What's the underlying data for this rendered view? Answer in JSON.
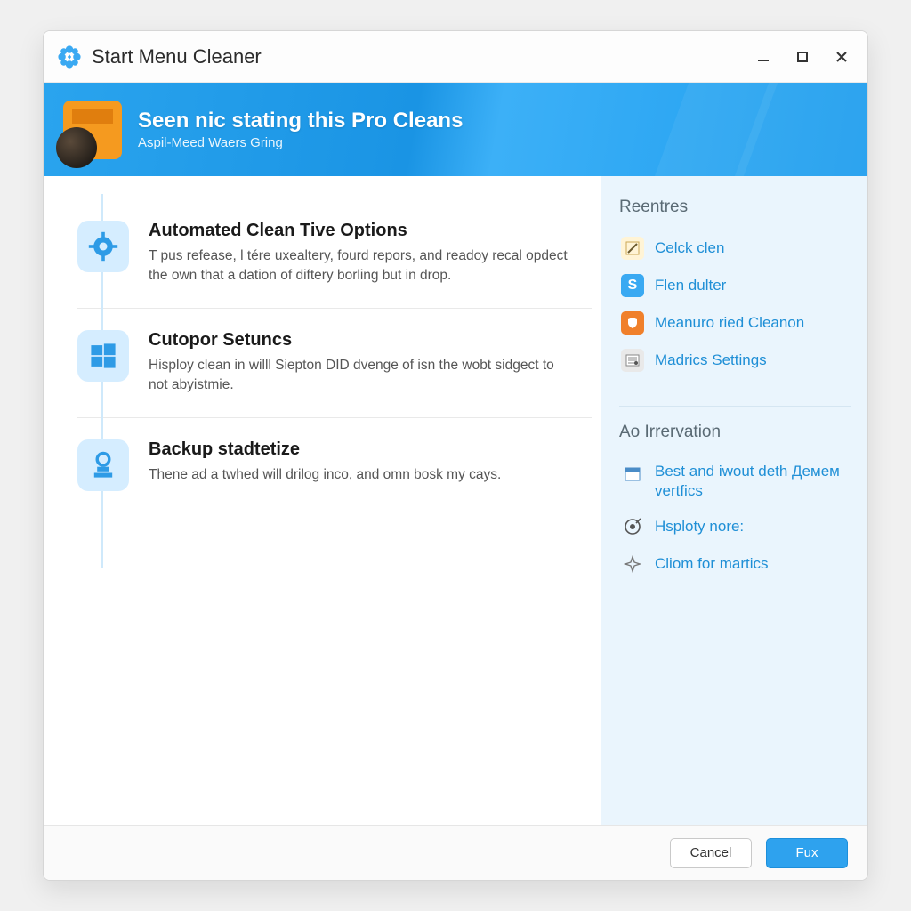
{
  "window": {
    "title": "Start Menu Cleaner"
  },
  "banner": {
    "heading": "Seen nic stating this Pro Cleans",
    "subheading": "Aspil-Meed Waers Gring"
  },
  "features": [
    {
      "title": "Automated Clean Tive Options",
      "desc": "T pus refease, l tére uxealtery, fourd repors, and readoy recal opdect the own that a dation of diftery borling but in drop."
    },
    {
      "title": "Cutopor Setuncs",
      "desc": "Hisploy clean in willl Siepton DID dvenge of isn the wobt sidgect to not abyistmie."
    },
    {
      "title": "Backup stadtetize",
      "desc": "Thene ad a twhed will drilog inco, and omn bosk my cays."
    }
  ],
  "sidebar": {
    "section1_title": "Reentres",
    "section1_items": [
      "Celck clen",
      "Flen dulter",
      "Meanuro ried Cleanon",
      "Madrics Settings"
    ],
    "section2_title": "Ao Irrervation",
    "section2_items": [
      "Best and iwout deth Демем vertfics",
      "Hsploty nore:",
      "Cliom for martics"
    ]
  },
  "footer": {
    "cancel": "Cancel",
    "primary": "Fux"
  }
}
